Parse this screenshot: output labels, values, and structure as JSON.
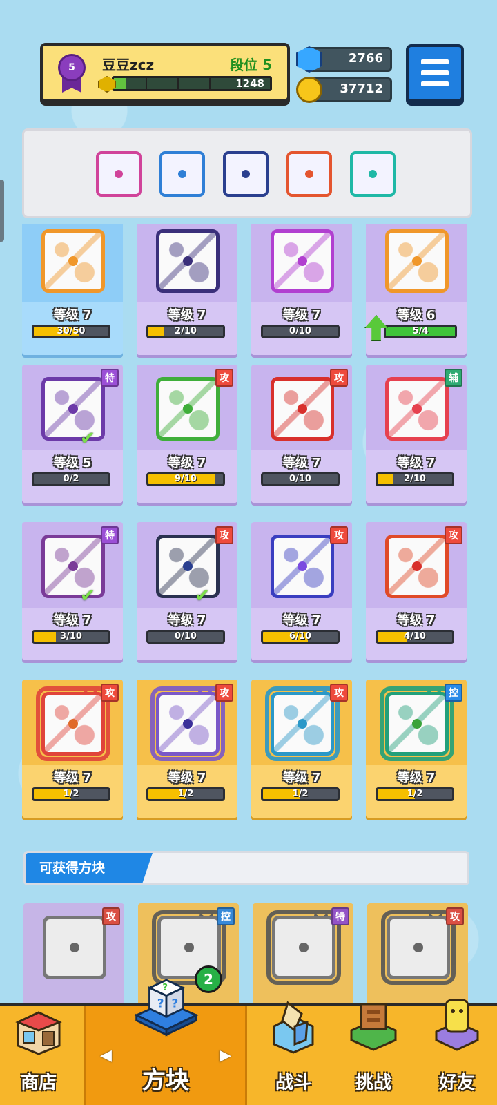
{
  "player": {
    "name": "豆豆zcz",
    "rank_number": "5",
    "rank_label": "段位 5",
    "xp_value": "1248",
    "xp_progress": 0.08
  },
  "currency": {
    "gems": "2766",
    "coins": "37712"
  },
  "deck": [
    {
      "icon": "purple-sweep-dice-icon",
      "border": "#d0439a"
    },
    {
      "icon": "cyan-frost-dice-icon",
      "border": "#2f7fd6"
    },
    {
      "icon": "gear-dice-icon",
      "border": "#2a3f8f"
    },
    {
      "icon": "rainbow-dice-icon",
      "border": "#e4552f"
    },
    {
      "icon": "healing-hands-dice-icon",
      "border": "#1fb8a6"
    }
  ],
  "cards": [
    {
      "level": "等级 7",
      "progress": "30/50",
      "fill": 0.6,
      "variant": "blue",
      "tag": "",
      "border": "#f0972a",
      "pip": "#f0972a",
      "icon": "bow-dice-icon"
    },
    {
      "level": "等级 7",
      "progress": "2/10",
      "fill": 0.2,
      "variant": "purple",
      "tag": "",
      "border": "#3a2f7a",
      "pip": "#3a2f7a",
      "icon": "scythe-dice-icon"
    },
    {
      "level": "等级 7",
      "progress": "0/10",
      "fill": 0,
      "variant": "purple",
      "tag": "",
      "border": "#b13fd0",
      "pip": "#b13fd0",
      "icon": "pixel-dice-icon"
    },
    {
      "level": "等级 6",
      "progress": "5/4",
      "fill": 1,
      "variant": "purple",
      "tag": "",
      "border": "#f0972a",
      "pip": "#f0972a",
      "icon": "target-dice-icon",
      "upgrade": true
    },
    {
      "level": "等级 5",
      "progress": "0/2",
      "fill": 0,
      "variant": "purple",
      "tag": "特",
      "tag_type": "spc",
      "border": "#6c3aa8",
      "pip": "#6c3aa8",
      "icon": "rainbow-dice-icon",
      "equipped": true
    },
    {
      "level": "等级 7",
      "progress": "9/10",
      "fill": 0.9,
      "variant": "purple",
      "tag": "攻",
      "tag_type": "atk",
      "border": "#3fae3a",
      "pip": "#3fae3a",
      "icon": "poison-dice-icon"
    },
    {
      "level": "等级 7",
      "progress": "0/10",
      "fill": 0,
      "variant": "purple",
      "tag": "攻",
      "tag_type": "atk",
      "border": "#d8302c",
      "pip": "#d8302c",
      "icon": "thunder-dice-icon"
    },
    {
      "level": "等级 7",
      "progress": "2/10",
      "fill": 0.2,
      "variant": "purple",
      "tag": "辅",
      "tag_type": "sup",
      "border": "#e6414f",
      "pip": "#e6414f",
      "icon": "cross-dice-icon"
    },
    {
      "level": "等级 7",
      "progress": "3/10",
      "fill": 0.3,
      "variant": "purple",
      "tag": "特",
      "tag_type": "spc",
      "border": "#7a3b98",
      "pip": "#7a3b98",
      "icon": "sweep-dice-icon",
      "equipped": true
    },
    {
      "level": "等级 7",
      "progress": "0/10",
      "fill": 0,
      "variant": "purple",
      "tag": "攻",
      "tag_type": "atk",
      "border": "#2a3150",
      "pip": "#2a3f8f",
      "icon": "gear-dice-icon",
      "equipped": true
    },
    {
      "level": "等级 7",
      "progress": "6/10",
      "fill": 0.6,
      "variant": "purple",
      "tag": "攻",
      "tag_type": "atk",
      "border": "#3a3ec0",
      "pip": "#7a4be0",
      "icon": "eye-dice-icon"
    },
    {
      "level": "等级 7",
      "progress": "4/10",
      "fill": 0.4,
      "variant": "purple",
      "tag": "攻",
      "tag_type": "atk",
      "border": "#e04a28",
      "pip": "#d8302c",
      "icon": "fire-dice-icon"
    },
    {
      "level": "等级 7",
      "progress": "1/2",
      "fill": 0.5,
      "variant": "gold",
      "tag": "攻",
      "tag_type": "atk",
      "border": "#e0443a",
      "pip": "#e06a2a",
      "icon": "red-dragon-dice-icon",
      "dragon": "#e0443a"
    },
    {
      "level": "等级 7",
      "progress": "1/2",
      "fill": 0.5,
      "variant": "gold",
      "tag": "攻",
      "tag_type": "atk",
      "border": "#7a58c8",
      "pip": "#3a2f9a",
      "icon": "purple-dragon-dice-icon",
      "dragon": "#7a58c8"
    },
    {
      "level": "等级 7",
      "progress": "1/2",
      "fill": 0.5,
      "variant": "gold",
      "tag": "攻",
      "tag_type": "atk",
      "border": "#2a98c8",
      "pip": "#2a98c8",
      "icon": "blue-dragon-dice-icon",
      "dragon": "#2a98c8"
    },
    {
      "level": "等级 7",
      "progress": "1/2",
      "fill": 0.5,
      "variant": "gold",
      "tag": "控",
      "tag_type": "ctl",
      "border": "#22a07a",
      "pip": "#3ba33a",
      "icon": "wind-dragon-dice-icon",
      "dragon": "#22a07a"
    }
  ],
  "available_section": {
    "title": "可获得方块"
  },
  "locked_cards": [
    {
      "tag": "攻",
      "tag_type": "atk",
      "variant": "purple",
      "icon": "swirl-dice-icon"
    },
    {
      "tag": "控",
      "tag_type": "ctl",
      "variant": "gold",
      "icon": "gray-dragon-dice-icon"
    },
    {
      "tag": "特",
      "tag_type": "spc",
      "variant": "gold",
      "icon": "infinity-dragon-dice-icon"
    },
    {
      "tag": "攻",
      "tag_type": "atk",
      "variant": "gold",
      "icon": "trident-dragon-dice-icon"
    }
  ],
  "nav": {
    "shop": "商店",
    "dice": "方块",
    "battle": "战斗",
    "challenge": "挑战",
    "friends": "好友",
    "dice_badge": "2"
  }
}
